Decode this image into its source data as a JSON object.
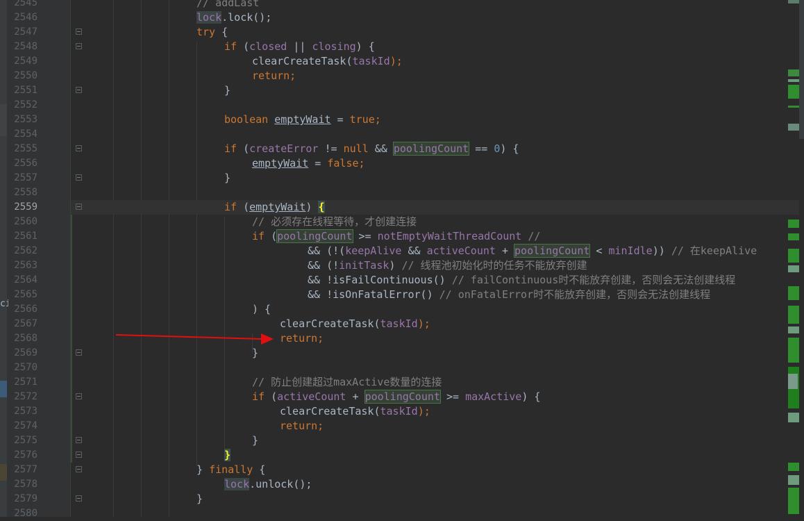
{
  "editor": {
    "line_numbers": [
      "2545",
      "2546",
      "2547",
      "2548",
      "2549",
      "2550",
      "2551",
      "2552",
      "2553",
      "2554",
      "2555",
      "2556",
      "2557",
      "2558",
      "2559",
      "2560",
      "2561",
      "2562",
      "2563",
      "2564",
      "2565",
      "2566",
      "2567",
      "2568",
      "2569",
      "2570",
      "2571",
      "2572",
      "2573",
      "2574",
      "2575",
      "2576",
      "2577",
      "2578",
      "2579",
      "2580"
    ],
    "current_line": "2559",
    "left_edge_text": "ci",
    "code": {
      "l2545": {
        "t1": "// addLast"
      },
      "l2546": {
        "t1": "lock",
        "t2": ".lock();"
      },
      "l2547": {
        "t1": "try",
        "t2": " {"
      },
      "l2548": {
        "t1": "if",
        "t2": " (",
        "t3": "closed",
        "t4": " || ",
        "t5": "closing",
        "t6": ") {"
      },
      "l2549": {
        "t1": "clearCreateTask(",
        "t2": "taskId",
        "t3": ");"
      },
      "l2550": {
        "t1": "return;"
      },
      "l2551": {
        "t1": "}"
      },
      "l2553": {
        "t1": "boolean",
        "t2": " ",
        "t3": "emptyWait",
        "t4": " = ",
        "t5": "true;"
      },
      "l2555": {
        "t1": "if",
        "t2": " (",
        "t3": "createError",
        "t4": " != ",
        "t5": "null",
        "t6": " && ",
        "t7": "poolingCount",
        "t8": " == ",
        "t9": "0",
        "t10": ") {"
      },
      "l2556": {
        "t1": "emptyWait",
        "t2": " = ",
        "t3": "false;"
      },
      "l2557": {
        "t1": "}"
      },
      "l2559": {
        "t1": "if",
        "t2": " (",
        "t3": "emptyWait",
        "t4": ") ",
        "t5": "{"
      },
      "l2560": {
        "t1": "// 必须存在线程等待，才创建连接"
      },
      "l2561": {
        "t1": "if",
        "t2": " (",
        "t3": "poolingCount",
        "t4": " >= ",
        "t5": "notEmptyWaitThreadCount",
        "t6": " //"
      },
      "l2562": {
        "t1": "&& (!(",
        "t2": "keepAlive",
        "t3": " && ",
        "t4": "activeCount",
        "t5": " + ",
        "t6": "poolingCount",
        "t7": " < ",
        "t8": "minIdle",
        "t9": ")) ",
        "t10": "// 在keepAlive"
      },
      "l2563": {
        "t1": "&& (!",
        "t2": "initTask",
        "t3": ") ",
        "t4": "// 线程池初始化时的任务不能放弃创建"
      },
      "l2564": {
        "t1": "&& !isFailContinuous() ",
        "t2": "// failContinuous时不能放弃创建，否则会无法创建线程"
      },
      "l2565": {
        "t1": "&& !isOnFatalError() ",
        "t2": "// onFatalError时不能放弃创建，否则会无法创建线程"
      },
      "l2566": {
        "t1": ") {"
      },
      "l2567": {
        "t1": "clearCreateTask(",
        "t2": "taskId",
        "t3": ");"
      },
      "l2568": {
        "t1": "return;"
      },
      "l2569": {
        "t1": "}"
      },
      "l2571": {
        "t1": "// 防止创建超过maxActive数量的连接"
      },
      "l2572": {
        "t1": "if",
        "t2": " (",
        "t3": "activeCount",
        "t4": " + ",
        "t5": "poolingCount",
        "t6": " >= ",
        "t7": "maxActive",
        "t8": ") {"
      },
      "l2573": {
        "t1": "clearCreateTask(",
        "t2": "taskId",
        "t3": ");"
      },
      "l2574": {
        "t1": "return;"
      },
      "l2575": {
        "t1": "}"
      },
      "l2576": {
        "t1": "}"
      },
      "l2577": {
        "t1": "}",
        "t2": " ",
        "t3": "finally",
        "t4": " {"
      },
      "l2578": {
        "t1": "lock",
        "t2": ".unlock();"
      },
      "l2579": {
        "t1": "}"
      }
    }
  },
  "colors": {
    "background": "#2b2b2b",
    "gutter": "#313335",
    "keyword": "#cc7832",
    "field": "#9876aa",
    "comment": "#808080",
    "number": "#6897bb",
    "text": "#a9b7c6",
    "arrow": "#e01010"
  }
}
